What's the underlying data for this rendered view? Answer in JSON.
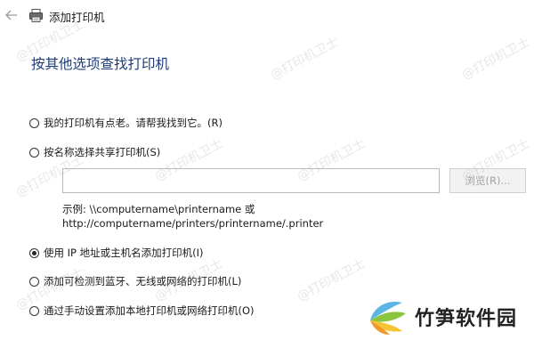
{
  "window": {
    "title": "添加打印机"
  },
  "heading": "按其他选项查找打印机",
  "options": [
    {
      "label": "我的打印机有点老。请帮我找到它。(R)",
      "checked": false
    },
    {
      "label": "按名称选择共享打印机(S)",
      "checked": false
    },
    {
      "label": "使用 IP 地址或主机名添加打印机(I)",
      "checked": true
    },
    {
      "label": "添加可检测到蓝牙、无线或网络的打印机(L)",
      "checked": false
    },
    {
      "label": "通过手动设置添加本地打印机或网络打印机(O)",
      "checked": false
    }
  ],
  "share_input": {
    "value": "",
    "placeholder": ""
  },
  "browse_button": "浏览(R)...",
  "example": {
    "line1": "示例: \\\\computername\\printername 或",
    "line2": "http://computername/printers/printername/.printer"
  },
  "watermark": "@打印机卫士",
  "brand": {
    "name": "竹笋软件园"
  },
  "colors": {
    "heading": "#1e3c78",
    "disabled_text": "#a3a3a3"
  },
  "icons": {
    "back": "back-arrow-icon",
    "printer": "printer-icon",
    "brand": "bamboo-leaf-logo"
  }
}
